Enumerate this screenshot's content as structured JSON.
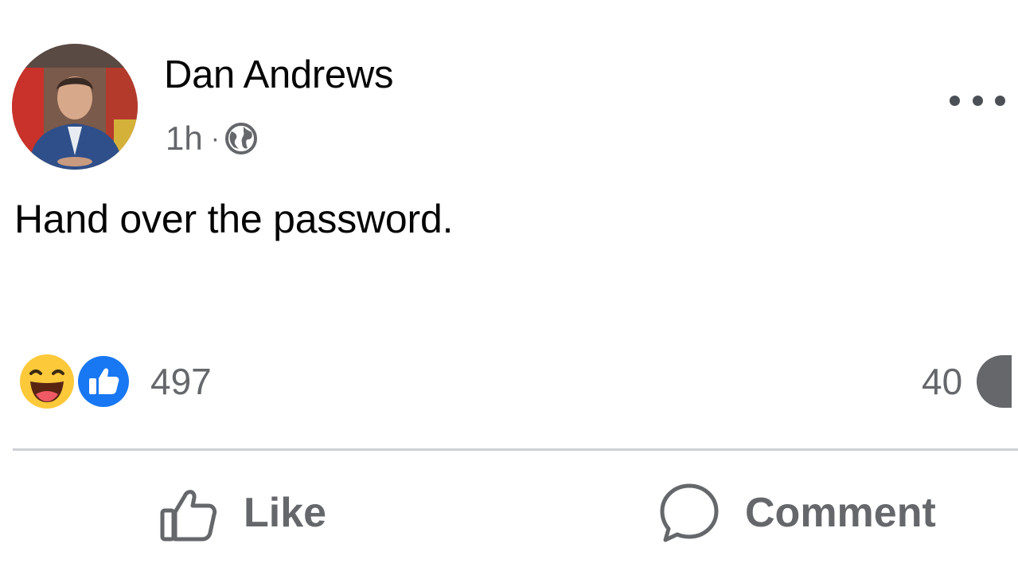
{
  "post": {
    "author": "Dan Andrews",
    "timestamp": "1h",
    "separator": "·",
    "audience_icon": "globe-icon",
    "text": "Hand over the password.",
    "more_icon": "more-options-icon"
  },
  "reactions": {
    "icons": [
      "haha-icon",
      "like-reaction-icon"
    ],
    "count": "497",
    "comment_count": "40"
  },
  "actions": {
    "like_label": "Like",
    "comment_label": "Comment"
  },
  "colors": {
    "text_primary": "#050505",
    "text_secondary": "#65676b",
    "like_blue": "#1877f2",
    "haha_yellow": "#fcc93b",
    "divider": "#ced0d4"
  }
}
